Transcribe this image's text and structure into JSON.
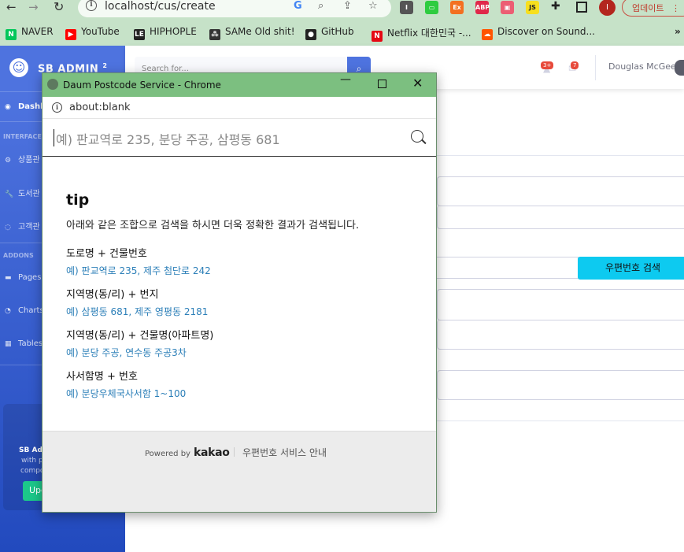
{
  "browser": {
    "url": "localhost/cus/create",
    "update_label": "업데이트",
    "bookmarks": [
      {
        "label": "NAVER",
        "icon": "naver-icon",
        "color": "#03c75a",
        "glyph": "N"
      },
      {
        "label": "YouTube",
        "icon": "youtube-icon",
        "color": "#ff0000",
        "glyph": "▶"
      },
      {
        "label": "HIPHOPLE",
        "icon": "hiphople-icon",
        "color": "#222222",
        "glyph": "LE"
      },
      {
        "label": "SAMe Old shit!",
        "icon": "same-icon",
        "color": "#333333",
        "glyph": "⁂"
      },
      {
        "label": "GitHub",
        "icon": "github-icon",
        "color": "#222222",
        "glyph": "●"
      },
      {
        "label": "Netflix 대한민국 -...",
        "icon": "netflix-icon",
        "color": "#e50914",
        "glyph": "N"
      },
      {
        "label": "Discover on Sound...",
        "icon": "soundcloud-icon",
        "color": "#ff5500",
        "glyph": "☁"
      }
    ],
    "more_bookmarks": "»",
    "extensions": [
      {
        "glyph": "I",
        "color": "#555555"
      },
      {
        "glyph": "▭",
        "color": "#2ecc40"
      },
      {
        "glyph": "Ex",
        "color": "#f37021"
      },
      {
        "glyph": "ABP",
        "color": "#e0284a"
      },
      {
        "glyph": "▣",
        "color": "#ec5e73"
      },
      {
        "glyph": "JS",
        "color": "#f7df1e"
      }
    ],
    "profile_initial": "I"
  },
  "sidebar": {
    "brand": "SB ADMIN",
    "brand_sup": "2",
    "dashboard": "Dashb",
    "interface_heading": "INTERFACE",
    "items": [
      {
        "label": "상품관",
        "icon": "⚙"
      },
      {
        "label": "도서관",
        "icon": "🔧"
      },
      {
        "label": "고객관",
        "icon": "◌"
      }
    ],
    "addons_heading": "ADDONS",
    "addon_items": [
      {
        "label": "Pages",
        "icon": "▬"
      },
      {
        "label": "Charts",
        "icon": "◔"
      },
      {
        "label": "Tables",
        "icon": "▦"
      }
    ],
    "card_line1": "SB Adm",
    "card_line2": "with p",
    "card_line3": "compo",
    "card_button": "Upg"
  },
  "topbar": {
    "search_placeholder": "Search for...",
    "alerts_badge": "3+",
    "messages_badge": "7",
    "user_name": "Douglas McGee"
  },
  "form": {
    "zip_button": "우편번호 검색"
  },
  "popup": {
    "window_title": "Daum Postcode Service - Chrome",
    "address": "about:blank",
    "search_placeholder": "예) 판교역로 235, 분당 주공, 삼평동 681",
    "tip_title": "tip",
    "tip_desc": "아래와 같은 조합으로 검색을 하시면 더욱 정확한 결과가 검색됩니다.",
    "categories": [
      {
        "label": "도로명 + 건물번호",
        "example": "예) 판교역로 235,  제주 첨단로 242"
      },
      {
        "label": "지역명(동/리) + 번지",
        "example": "예) 삼평동 681,  제주 영평동 2181"
      },
      {
        "label": "지역명(동/리) + 건물명(아파트명)",
        "example": "예) 분당 주공,  연수동 주공3차"
      },
      {
        "label": "사서함명 + 번호",
        "example": "예) 분당우체국사서함 1~100"
      }
    ],
    "powered_by": "Powered by",
    "kakao": "kakao",
    "guide": "우편번호 서비스 안내"
  }
}
